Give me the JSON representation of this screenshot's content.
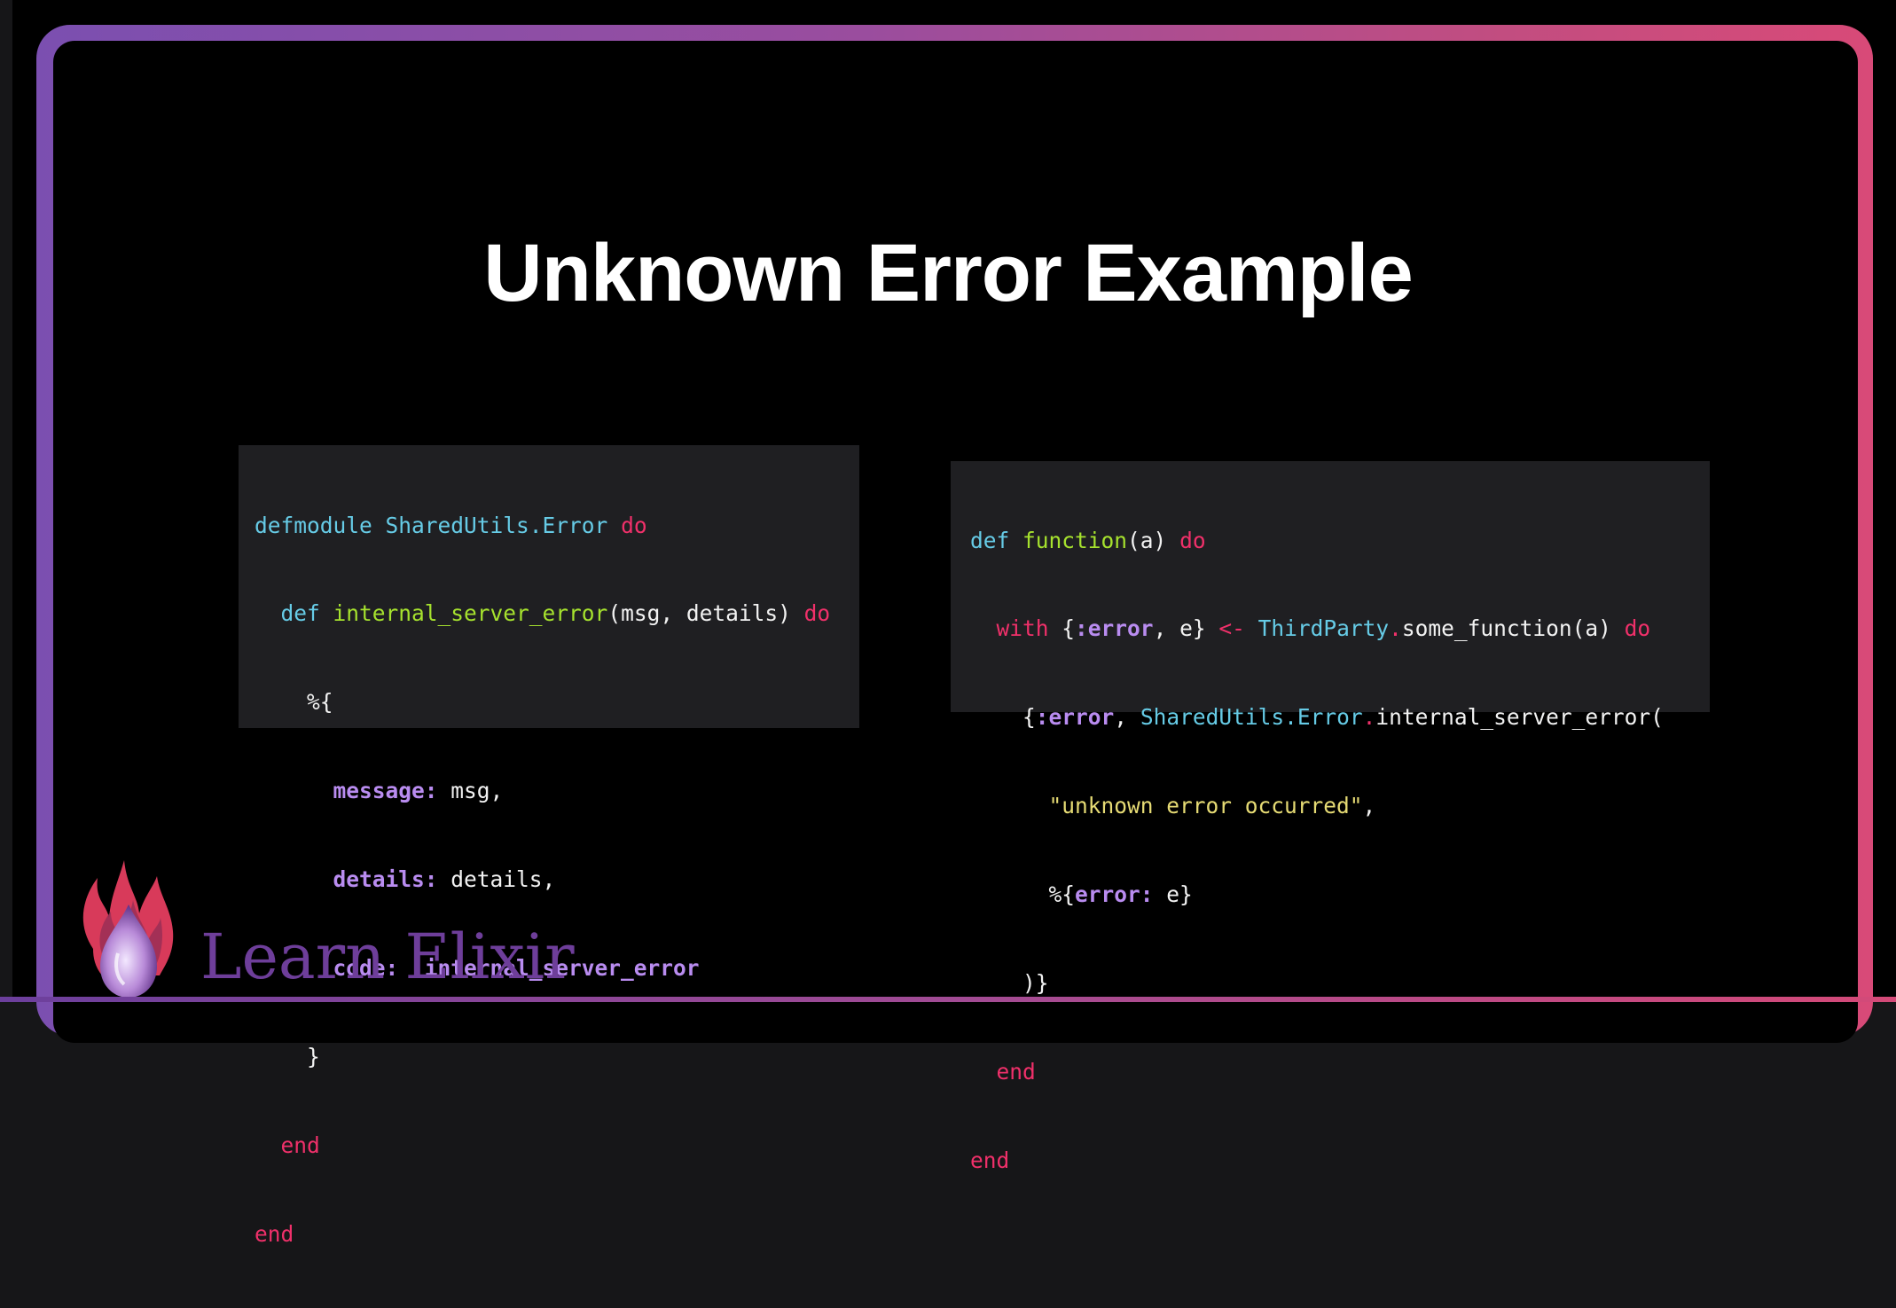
{
  "slide": {
    "title": "Unknown Error Example",
    "brand": "Learn Elixir",
    "colors": {
      "frame_start": "#7b4fb0",
      "frame_end": "#d84a78",
      "code_bg": "#1f1f22",
      "keyword": "#66cbe6",
      "function": "#a6e22e",
      "control": "#f0306a",
      "atom": "#b98cf0",
      "string": "#e6db74"
    },
    "icons": {
      "logo": "elixir-flame-drop-logo"
    }
  },
  "code_left": {
    "l1": {
      "a": "defmodule",
      "b": " ",
      "c": "SharedUtils.Error",
      "d": " ",
      "e": "do"
    },
    "l2": {
      "indent": "  ",
      "a": "def",
      "b": " ",
      "c": "internal_server_error",
      "d": "(msg, details) ",
      "e": "do"
    },
    "l3": {
      "text": "    %{"
    },
    "l4": {
      "indent": "      ",
      "key": "message:",
      "val": " msg,"
    },
    "l5": {
      "indent": "      ",
      "key": "details:",
      "val": " details,"
    },
    "l6": {
      "indent": "      ",
      "key": "code:",
      "val": " ",
      "atom": ":internal_server_error"
    },
    "l7": {
      "text": "    }"
    },
    "l8": {
      "indent": "  ",
      "kw": "end"
    },
    "l9": {
      "kw": "end"
    }
  },
  "code_right": {
    "l1": {
      "a": "def",
      "b": " ",
      "c": "function",
      "d": "(a) ",
      "e": "do"
    },
    "l2": {
      "indent": "  ",
      "with": "with",
      "p1": " {",
      "atom": ":error",
      "p2": ", e} ",
      "arrow": "<-",
      "sp": " ",
      "mod": "ThirdParty",
      "dot": ".",
      "call": "some_function(a) ",
      "do": "do"
    },
    "l3": {
      "indent": "    ",
      "p1": "{",
      "atom": ":error",
      "p2": ", ",
      "mod": "SharedUtils.Error",
      "dot": ".",
      "call": "internal_server_error("
    },
    "l4": {
      "indent": "      ",
      "str": "\"unknown error occurred\"",
      "comma": ","
    },
    "l5": {
      "indent": "      ",
      "p1": "%{",
      "key": "error:",
      "p2": " e}"
    },
    "l6": {
      "text": "    )}"
    },
    "l7": {
      "indent": "  ",
      "kw": "end"
    },
    "l8": {
      "kw": "end"
    }
  }
}
